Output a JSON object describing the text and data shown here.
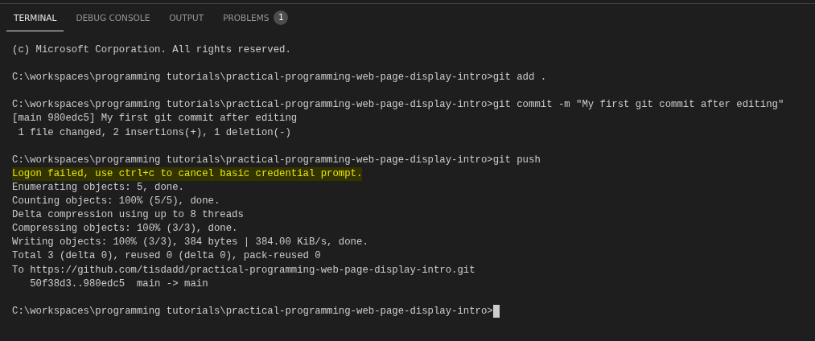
{
  "tabs": [
    {
      "label": "TERMINAL",
      "selected": true
    },
    {
      "label": "DEBUG CONSOLE",
      "selected": false
    },
    {
      "label": "OUTPUT",
      "selected": false
    },
    {
      "label": "PROBLEMS",
      "selected": false,
      "badge": "1"
    }
  ],
  "terminal": {
    "lines": [
      {
        "kind": "text",
        "text": "(c) Microsoft Corporation. All rights reserved."
      },
      {
        "kind": "blank"
      },
      {
        "kind": "text",
        "text": "C:\\workspaces\\programming tutorials\\practical-programming-web-page-display-intro>git add ."
      },
      {
        "kind": "blank"
      },
      {
        "kind": "text",
        "text": "C:\\workspaces\\programming tutorials\\practical-programming-web-page-display-intro>git commit -m \"My first git commit after editing\""
      },
      {
        "kind": "text",
        "text": "[main 980edc5] My first git commit after editing"
      },
      {
        "kind": "text",
        "text": " 1 file changed, 2 insertions(+), 1 deletion(-)"
      },
      {
        "kind": "blank"
      },
      {
        "kind": "text",
        "text": "C:\\workspaces\\programming tutorials\\practical-programming-web-page-display-intro>git push"
      },
      {
        "kind": "warning",
        "text": "Logon failed, use ctrl+c to cancel basic credential prompt."
      },
      {
        "kind": "text",
        "text": "Enumerating objects: 5, done."
      },
      {
        "kind": "text",
        "text": "Counting objects: 100% (5/5), done."
      },
      {
        "kind": "text",
        "text": "Delta compression using up to 8 threads"
      },
      {
        "kind": "text",
        "text": "Compressing objects: 100% (3/3), done."
      },
      {
        "kind": "text",
        "text": "Writing objects: 100% (3/3), 384 bytes | 384.00 KiB/s, done."
      },
      {
        "kind": "text",
        "text": "Total 3 (delta 0), reused 0 (delta 0), pack-reused 0"
      },
      {
        "kind": "text",
        "text": "To https://github.com/tisdadd/practical-programming-web-page-display-intro.git"
      },
      {
        "kind": "text",
        "text": "   50f38d3..980edc5  main -> main"
      },
      {
        "kind": "blank"
      },
      {
        "kind": "prompt",
        "text": "C:\\workspaces\\programming tutorials\\practical-programming-web-page-display-intro>",
        "cursor": true
      }
    ]
  }
}
